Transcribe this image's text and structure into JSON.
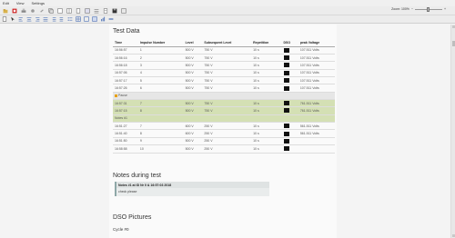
{
  "menu": [
    "Edit",
    "View",
    "Settings"
  ],
  "zoom": {
    "label": "Zoom: 100%",
    "level": 0.5
  },
  "sections": {
    "test_data": "Test Data",
    "notes": "Notes during test",
    "dso": "DSO Pictures",
    "cycle": "Cycle #0"
  },
  "table": {
    "headers": [
      "Time",
      "Impulse Number",
      "Level",
      "Subsequent Level",
      "Repetition",
      "DSO",
      "peak Voltage"
    ],
    "rows": [
      {
        "type": "data",
        "cells": [
          "16:56:57",
          "1",
          "500 V",
          "750 V",
          "10 s",
          "",
          "107.511 Volts"
        ]
      },
      {
        "type": "data",
        "cells": [
          "16:56:16",
          "2",
          "500 V",
          "750 V",
          "10 s",
          "",
          "107.511 Volts"
        ]
      },
      {
        "type": "data",
        "cells": [
          "16:56:18",
          "3",
          "500 V",
          "750 V",
          "10 s",
          "",
          "107.511 Volts"
        ]
      },
      {
        "type": "data",
        "cells": [
          "16:57:06",
          "4",
          "500 V",
          "750 V",
          "10 s",
          "",
          "107.511 Volts"
        ]
      },
      {
        "type": "data",
        "cells": [
          "16:57:17",
          "5",
          "500 V",
          "750 V",
          "10 s",
          "",
          "107.511 Volts"
        ]
      },
      {
        "type": "data",
        "cells": [
          "16:57:26",
          "6",
          "500 V",
          "750 V",
          "10 s",
          "",
          "107.511 Volts"
        ]
      },
      {
        "type": "group",
        "label": "Pause"
      },
      {
        "type": "hl",
        "cells": [
          "16:57:31",
          "7",
          "500 V",
          "750 V",
          "10 s",
          "",
          "761.511 Volts"
        ]
      },
      {
        "type": "hl",
        "cells": [
          "16:57:15",
          "8",
          "500 V",
          "750 V",
          "10 s",
          "",
          "761.511 Volts"
        ]
      },
      {
        "type": "hl-label",
        "label": "Notes #1"
      },
      {
        "type": "data",
        "cells": [
          "16:51:27",
          "7",
          "600 V",
          "250 V",
          "10 s",
          "",
          "561.511 Volts"
        ]
      },
      {
        "type": "data",
        "cells": [
          "16:51:40",
          "8",
          "600 V",
          "250 V",
          "10 s",
          "",
          "561.511 Volts"
        ]
      },
      {
        "type": "data",
        "cells": [
          "16:51:50",
          "9",
          "500 V",
          "250 V",
          "10 s",
          "",
          ""
        ]
      },
      {
        "type": "data",
        "cells": [
          "16:58:58",
          "10",
          "500 V",
          "250 V",
          "10 s",
          "",
          ""
        ]
      }
    ]
  },
  "note": {
    "header": "Notes #1 at ID Nr 0 & 16:57:03 2018",
    "body": "check please"
  }
}
